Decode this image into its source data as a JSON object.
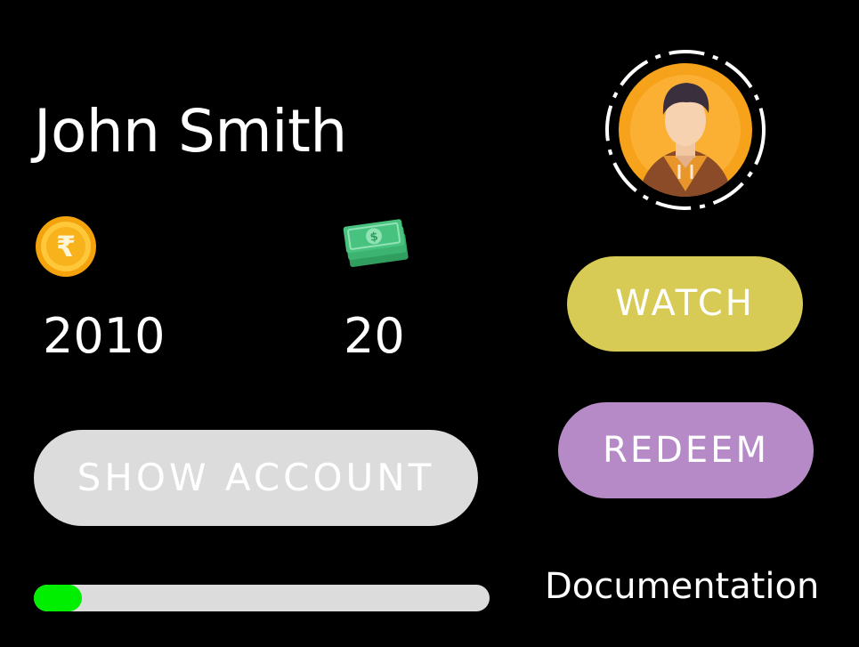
{
  "profile": {
    "name": "John Smith",
    "avatar_icon": "user-avatar-icon"
  },
  "stats": {
    "coins": {
      "icon": "rupee-coin-icon",
      "value": "2010"
    },
    "cash": {
      "icon": "cash-stack-icon",
      "value": "20"
    }
  },
  "actions": {
    "show_account_label": "SHOW ACCOUNT",
    "watch_label": "WATCH",
    "redeem_label": "REDEEM",
    "documentation_label": "Documentation"
  },
  "progress": {
    "fraction": 0.105
  },
  "colors": {
    "background": "#000000",
    "show_account_button": "#dcdcdc",
    "watch_button": "#d8cb55",
    "redeem_button": "#b58ac6",
    "progress_track": "#dcdcdc",
    "progress_fill": "#00ee00",
    "text": "#ffffff"
  }
}
